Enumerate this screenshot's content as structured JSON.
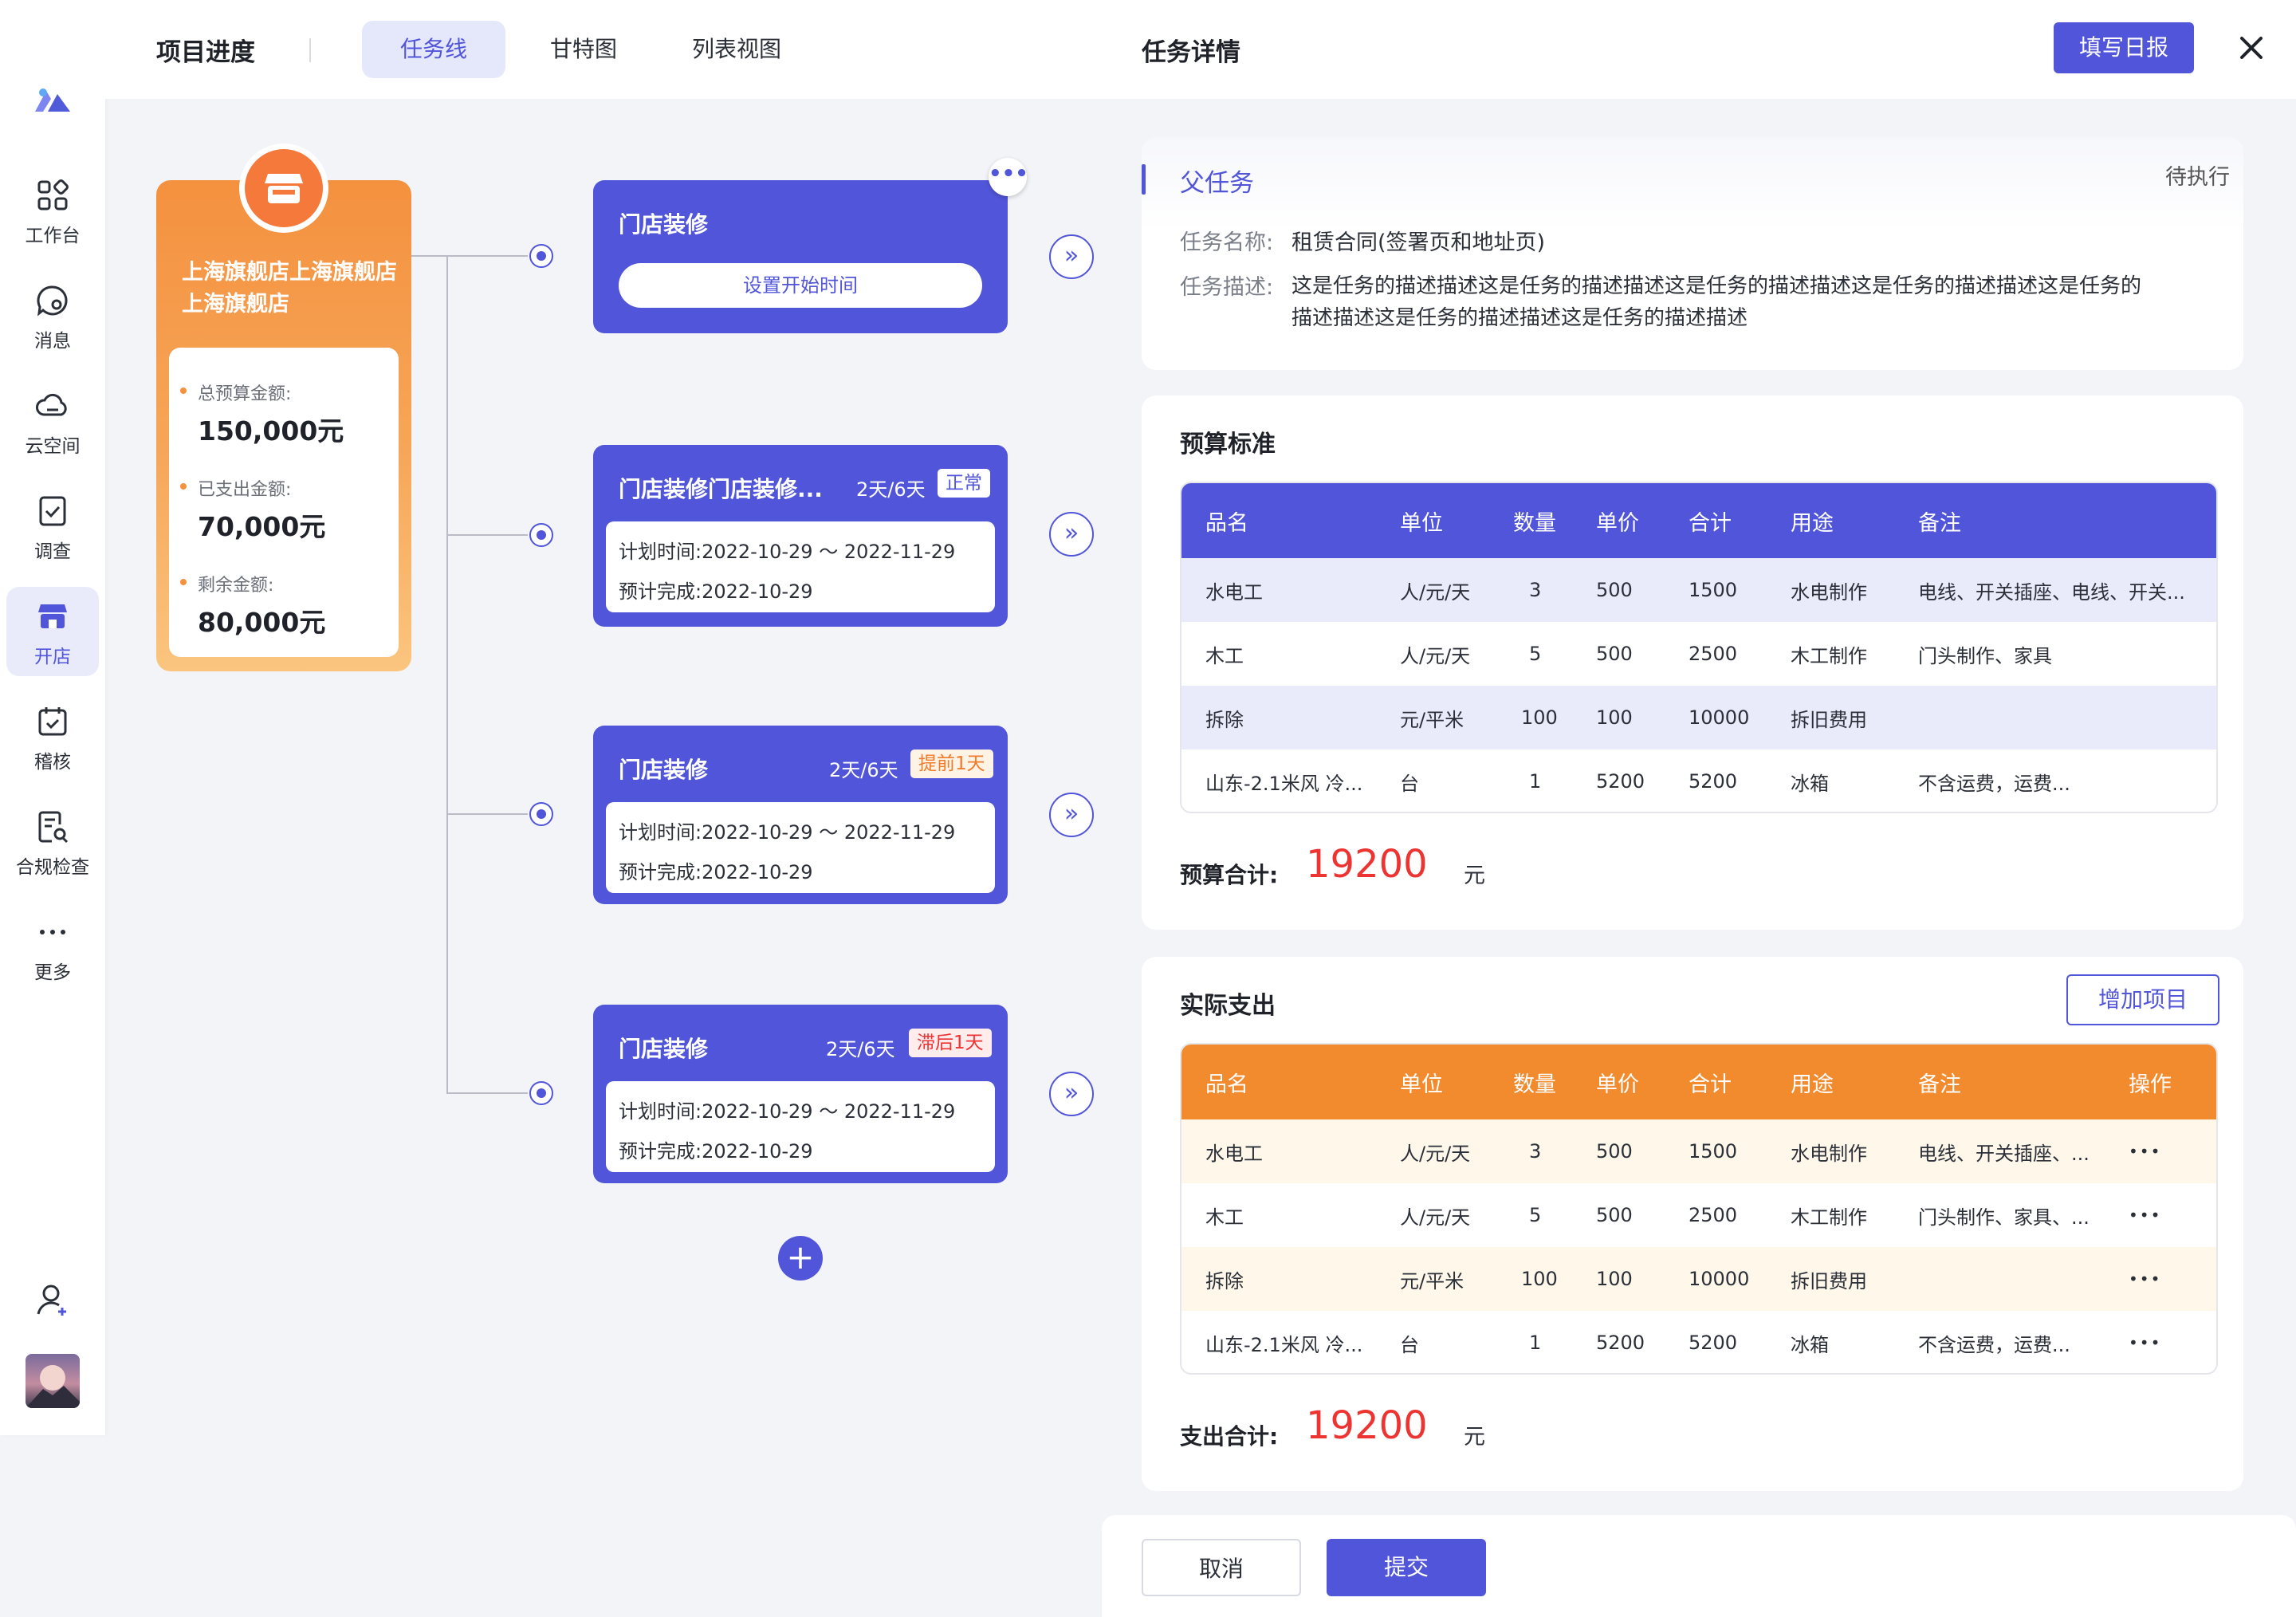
{
  "app": {
    "window_controls": [
      "close",
      "minimize",
      "maximize"
    ],
    "logo_icon": "brand-logo-icon"
  },
  "sidebar": {
    "items": [
      {
        "label": "工作台",
        "icon": "grid-icon"
      },
      {
        "label": "消息",
        "icon": "message-icon"
      },
      {
        "label": "云空间",
        "icon": "cloud-icon"
      },
      {
        "label": "调查",
        "icon": "checklist-icon"
      },
      {
        "label": "开店",
        "icon": "store-icon",
        "active": true
      },
      {
        "label": "稽核",
        "icon": "audit-icon"
      },
      {
        "label": "合规检查",
        "icon": "compliance-icon"
      },
      {
        "label": "更多",
        "icon": "more-icon"
      }
    ],
    "bottom": {
      "add_user_icon": "add-user-icon",
      "avatar": "avatar"
    }
  },
  "header": {
    "title": "项目进度",
    "tabs": [
      {
        "label": "任务线",
        "active": true
      },
      {
        "label": "甘特图"
      },
      {
        "label": "列表视图"
      }
    ]
  },
  "store": {
    "name": "上海旗舰店上海旗舰店上海旗舰店",
    "budget": [
      {
        "label": "总预算金额:",
        "value": "150,000元"
      },
      {
        "label": "已支出金额:",
        "value": "70,000元"
      },
      {
        "label": "剩余金额:",
        "value": "80,000元"
      }
    ]
  },
  "tasks": [
    {
      "title": "门店装修",
      "button": "设置开始时间"
    },
    {
      "title": "门店装修门店装修...",
      "days": "2天/6天",
      "badge": "正常",
      "badge_color": "#5155d9",
      "plan_label": "计划时间:",
      "plan": "2022-10-29 ～ 2022-11-29",
      "done_label": "预计完成:",
      "done": "2022-10-29"
    },
    {
      "title": "门店装修",
      "days": "2天/6天",
      "badge": "提前1天",
      "badge_color": "#f07b2a",
      "plan_label": "计划时间:",
      "plan": "2022-10-29 ～ 2022-11-29",
      "done_label": "预计完成:",
      "done": "2022-10-29"
    },
    {
      "title": "门店装修",
      "days": "2天/6天",
      "badge": "滞后1天",
      "badge_color": "#ee3333",
      "plan_label": "计划时间:",
      "plan": "2022-10-29 ～ 2022-11-29",
      "done_label": "预计完成:",
      "done": "2022-10-29"
    }
  ],
  "detail": {
    "title": "任务详情",
    "report_button": "填写日报",
    "close_icon": "close-icon",
    "parent": {
      "title": "父任务",
      "status": "待执行",
      "name_label": "任务名称:",
      "name": "租赁合同(签署页和地址页)",
      "desc_label": "任务描述:",
      "desc_line1": "这是任务的描述描述这是任务的描述描述这是任务的描述描述这是任务的描述描述这是任务的",
      "desc_line2": "描述描述这是任务的描述描述这是任务的描述描述"
    },
    "budget": {
      "title": "预算标准",
      "columns": [
        "品名",
        "单位",
        "数量",
        "单价",
        "合计",
        "用途",
        "备注"
      ],
      "rows": [
        [
          "水电工",
          "人/元/天",
          "3",
          "500",
          "1500",
          "水电制作",
          "电线、开关插座、电线、开关..."
        ],
        [
          "木工",
          "人/元/天",
          "5",
          "500",
          "2500",
          "木工制作",
          "门头制作、家具"
        ],
        [
          "拆除",
          "元/平米",
          "100",
          "100",
          "10000",
          "拆旧费用",
          ""
        ],
        [
          "山东-2.1米风 冷...",
          "台",
          "1",
          "5200",
          "5200",
          "冰箱",
          "不含运费，运费..."
        ]
      ],
      "sum_label": "预算合计:",
      "sum_value": "19200",
      "sum_unit": "元"
    },
    "actual": {
      "title": "实际支出",
      "add_button": "增加项目",
      "columns": [
        "品名",
        "单位",
        "数量",
        "单价",
        "合计",
        "用途",
        "备注",
        "操作"
      ],
      "rows": [
        [
          "水电工",
          "人/元/天",
          "3",
          "500",
          "1500",
          "水电制作",
          "电线、开关插座、..."
        ],
        [
          "木工",
          "人/元/天",
          "5",
          "500",
          "2500",
          "木工制作",
          "门头制作、家具、..."
        ],
        [
          "拆除",
          "元/平米",
          "100",
          "100",
          "10000",
          "拆旧费用",
          ""
        ],
        [
          "山东-2.1米风 冷...",
          "台",
          "1",
          "5200",
          "5200",
          "冰箱",
          "不含运费，运费..."
        ]
      ],
      "row_action": "•••",
      "sum_label": "支出合计:",
      "sum_value": "19200",
      "sum_unit": "元"
    },
    "footer": {
      "cancel": "取消",
      "submit": "提交"
    }
  },
  "colors": {
    "accent": "#5155d9",
    "orange": "#f4913f",
    "red": "#ee3333",
    "table_orange": "#f28a2e"
  }
}
